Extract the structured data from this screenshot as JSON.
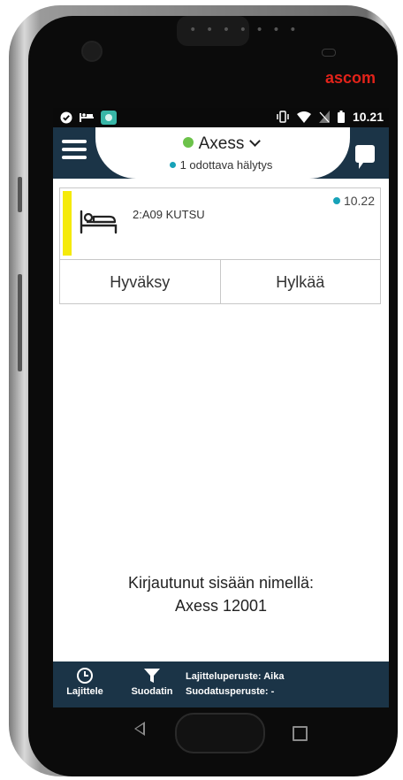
{
  "device": {
    "brand": "ascom",
    "speaker_dots": "• • • • • • •"
  },
  "status_bar": {
    "time": "10.21",
    "left_icons": [
      "check-circle-icon",
      "bed-icon",
      "app-icon"
    ],
    "right_icons": [
      "vibrate-icon",
      "wifi-icon",
      "no-sim-icon",
      "battery-icon"
    ]
  },
  "header": {
    "profile_name": "Axess",
    "profile_status_color": "#6cc24a",
    "pending_text": "1 odottava hälytys",
    "pending_dot_color": "#17a2b8",
    "bar_color": "#1b3447"
  },
  "alarm": {
    "title": "2:A09 KUTSU",
    "time": "10.22",
    "priority_color": "#f5ea0a",
    "icon": "patient-bed-icon",
    "accept_label": "Hyväksy",
    "reject_label": "Hylkää"
  },
  "login": {
    "line1": "Kirjautunut sisään nimellä:",
    "line2": "Axess 12001"
  },
  "bottom_bar": {
    "sort_label": "Lajittele",
    "filter_label": "Suodatin",
    "sort_criteria": "Lajitteluperuste: Aika",
    "filter_criteria": "Suodatusperuste: -"
  }
}
